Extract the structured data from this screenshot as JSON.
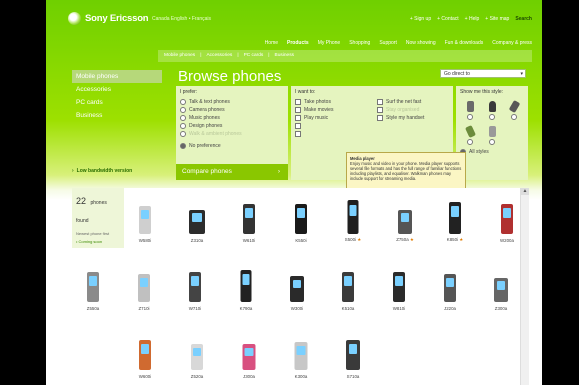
{
  "brand": "Sony Ericsson",
  "locale": "Canada English  •  Français",
  "utility": [
    "+ Sign up",
    "+ Contact",
    "+ Help",
    "+ Site map"
  ],
  "search_label": "Search",
  "main_nav": [
    "Home",
    "Products",
    "My Phone",
    "Shopping",
    "Support",
    "Now showing",
    "Fun & downloads",
    "Company & press"
  ],
  "main_nav_active": "Products",
  "breadcrumb": [
    "Mobile phones",
    "|",
    "Accessories",
    "|",
    "PC cards",
    "|",
    "Business"
  ],
  "sidebar": [
    "Mobile phones",
    "Accessories",
    "PC cards",
    "Business"
  ],
  "low_bandwidth": "Low bandwidth version",
  "page_title": "Browse phones",
  "go_directly": "Go direct to",
  "prefer": {
    "title": "I prefer:",
    "options": [
      "Talk & text phones",
      "Camera phones",
      "Music phones",
      "Design phones",
      "Walk & ambient phones"
    ],
    "no_pref": "No preference"
  },
  "want": {
    "title": "I want to:",
    "col1": [
      "Take photos",
      "Make movies",
      "Play music",
      "",
      ""
    ],
    "col2": [
      "Surf the net fast",
      "Stay organised",
      "Style my handset"
    ]
  },
  "styles_title": "Show me this style:",
  "all_styles": "All styles",
  "compare_label": "Compare phones",
  "tooltip": {
    "title": "Media player",
    "text": "Enjoy music and video in your phone. Media player supports several file formats and has the full range of familiar functions including playlists, and equaliser. Walkman phones may include support for streaming media."
  },
  "found": {
    "count": "22",
    "label": "phones found",
    "sort": "Newest phone first",
    "coming": "• Coming soon"
  },
  "phones": [
    {
      "name": "W580i",
      "star": false
    },
    {
      "name": "Z310a",
      "star": false
    },
    {
      "name": "W610i",
      "star": false
    },
    {
      "name": "K550i",
      "star": false
    },
    {
      "name": "S500i",
      "star": true
    },
    {
      "name": "Z750a",
      "star": true
    },
    {
      "name": "K850i",
      "star": true
    },
    {
      "name": "W200a",
      "star": false
    },
    {
      "name": "Z550a",
      "star": false
    },
    {
      "name": "Z710i",
      "star": false
    },
    {
      "name": "W710i",
      "star": false
    },
    {
      "name": "K790a",
      "star": false
    },
    {
      "name": "W300i",
      "star": false
    },
    {
      "name": "K510a",
      "star": false
    },
    {
      "name": "W810i",
      "star": false
    },
    {
      "name": "J220a",
      "star": false
    },
    {
      "name": "Z300a",
      "star": false
    },
    {
      "name": "W600i",
      "star": false
    },
    {
      "name": "Z520a",
      "star": false
    },
    {
      "name": "J300a",
      "star": false
    },
    {
      "name": "K300a",
      "star": false
    },
    {
      "name": "S710a",
      "star": false
    }
  ],
  "colors": {
    "brand_green": "#7fd400",
    "panel": "#e5f4bf",
    "compare": "#8ac700"
  }
}
